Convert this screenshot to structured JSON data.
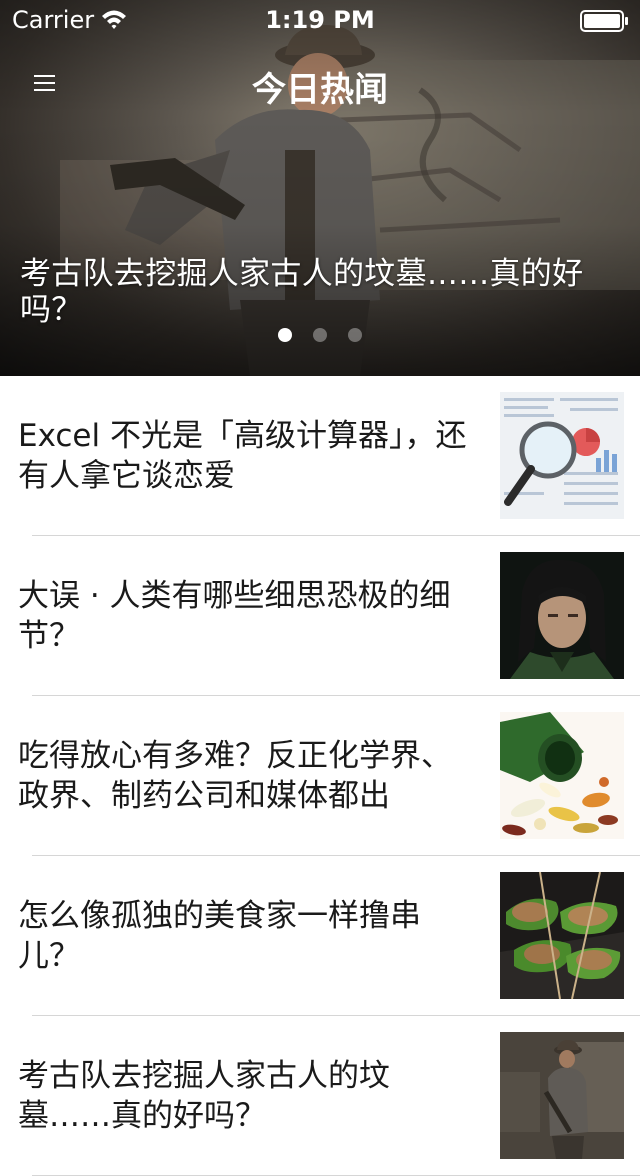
{
  "status_bar": {
    "carrier": "Carrier",
    "time": "1:19 PM"
  },
  "nav": {
    "title": "今日热闻",
    "menu_icon": "hamburger-menu-icon"
  },
  "hero": {
    "title": "考古队去挖掘人家古人的坟墓……真的好吗？",
    "page_count": 3,
    "active_page": 1
  },
  "news": [
    {
      "title": "Excel 不光是「高级计算器」，还有人拿它谈恋爱",
      "thumb": "spreadsheet-magnifier"
    },
    {
      "title": "大误 · 人类有哪些细思恐极的细节？",
      "thumb": "dark-haired-man-portrait"
    },
    {
      "title": "吃得放心有多难？反正化学界、政界、制药公司和媒体都出",
      "thumb": "pills-spilling-from-bottle"
    },
    {
      "title": "怎么像孤独的美食家一样撸串儿？",
      "thumb": "grilled-peppers-skewers"
    },
    {
      "title": "考古队去挖掘人家古人的坟墓……真的好吗？",
      "thumb": "archaeologist-in-tomb"
    }
  ],
  "colors": {
    "separator": "#d6d6d6",
    "text": "#1a1a1a",
    "status_text": "#ffffff"
  }
}
